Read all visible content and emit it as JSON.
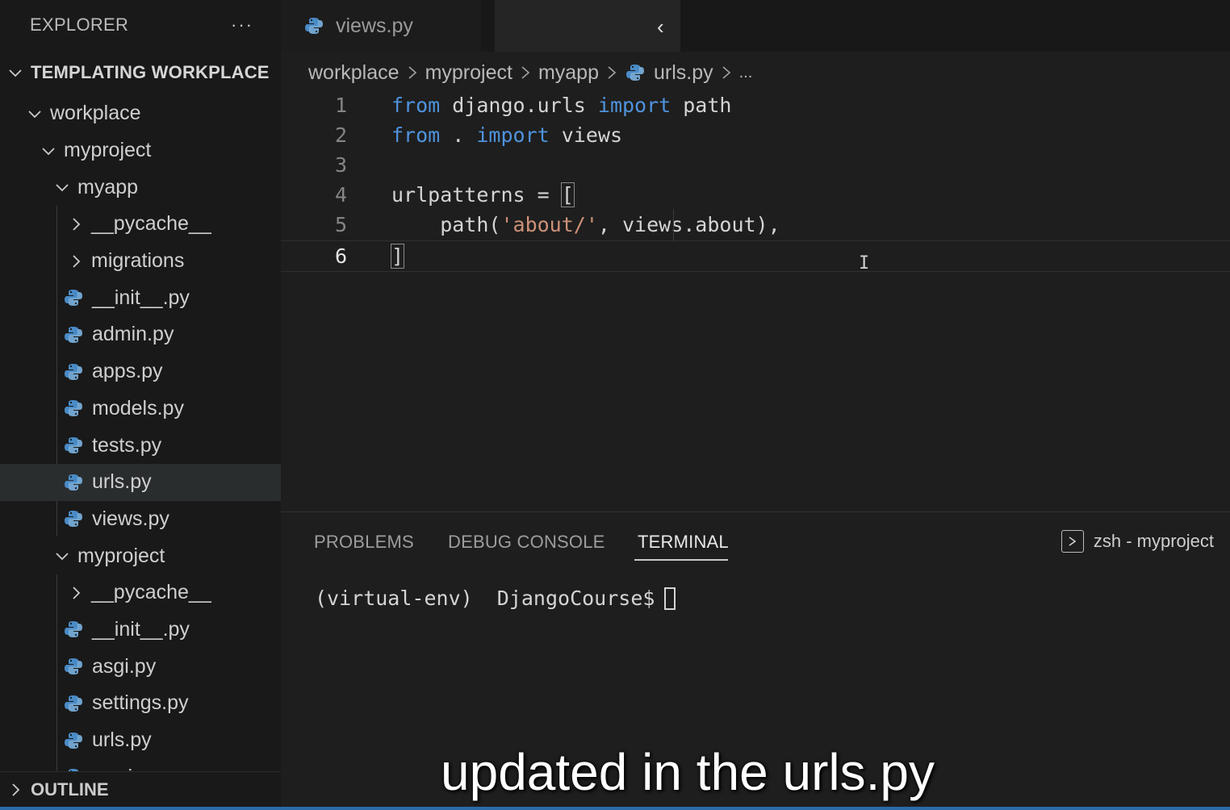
{
  "sidebar": {
    "title": "EXPLORER",
    "more_label": "···",
    "workspace": "TEMPLATING WORKPLACE",
    "tree": [
      {
        "label": "workplace",
        "kind": "folder-open"
      },
      {
        "label": "myproject",
        "kind": "folder-open"
      },
      {
        "label": "myapp",
        "kind": "folder-open"
      },
      {
        "label": "__pycache__",
        "kind": "folder-closed"
      },
      {
        "label": "migrations",
        "kind": "folder-closed"
      },
      {
        "label": "__init__.py",
        "kind": "file"
      },
      {
        "label": "admin.py",
        "kind": "file"
      },
      {
        "label": "apps.py",
        "kind": "file"
      },
      {
        "label": "models.py",
        "kind": "file"
      },
      {
        "label": "tests.py",
        "kind": "file"
      },
      {
        "label": "urls.py",
        "kind": "file",
        "selected": true
      },
      {
        "label": "views.py",
        "kind": "file"
      },
      {
        "label": "myproject",
        "kind": "folder-open"
      },
      {
        "label": "__pycache__",
        "kind": "folder-closed"
      },
      {
        "label": "__init__.py",
        "kind": "file"
      },
      {
        "label": "asgi.py",
        "kind": "file"
      },
      {
        "label": "settings.py",
        "kind": "file"
      },
      {
        "label": "urls.py",
        "kind": "file"
      },
      {
        "label": "wsgi.py",
        "kind": "file"
      }
    ],
    "outline": "OUTLINE"
  },
  "tabs": {
    "active_tab": "views.py"
  },
  "breadcrumb": {
    "items": [
      "workplace",
      "myproject",
      "myapp",
      "urls.py",
      "..."
    ]
  },
  "editor": {
    "line_numbers": [
      "1",
      "2",
      "3",
      "4",
      "5",
      "6"
    ],
    "lines": {
      "l1_kw1": "from",
      "l1_mod": " django.urls ",
      "l1_kw2": "import",
      "l1_name": " path",
      "l2_kw1": "from",
      "l2_mod": " . ",
      "l2_kw2": "import",
      "l2_name": " views",
      "l4_a": "urlpatterns = ",
      "l4_b": "[",
      "l5_a": "    path(",
      "l5_str": "'about/'",
      "l5_b": ", views.about),",
      "l6_a": "]"
    }
  },
  "panel": {
    "tabs": [
      "PROBLEMS",
      "DEBUG CONSOLE",
      "TERMINAL"
    ],
    "active_tab": "TERMINAL",
    "terminal_name": "zsh - myproject",
    "prompt_env": "(virtual-env)",
    "prompt_dir": "  DjangoCourse$"
  },
  "caption": "updated in the urls.py",
  "colors": {
    "keyword": "#4f93dd",
    "string": "#ce9178",
    "background": "#1e1e1e",
    "sidebar": "#191919"
  }
}
